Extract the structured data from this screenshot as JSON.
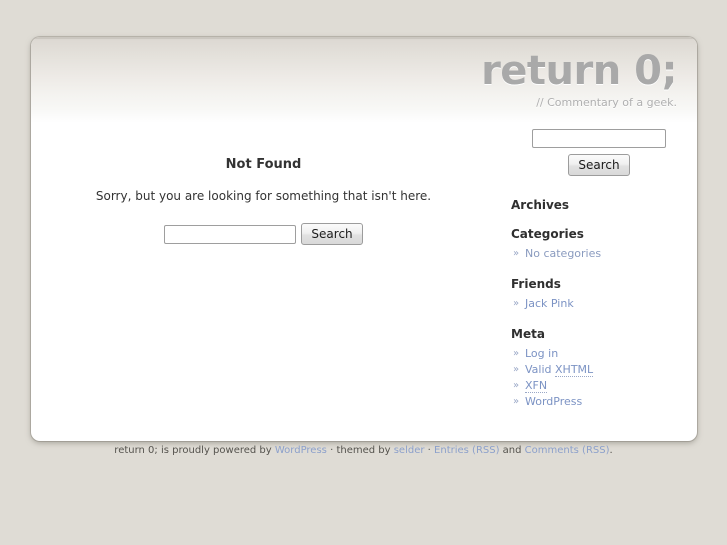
{
  "site": {
    "title": "return 0;",
    "description": "// Commentary of a geek."
  },
  "content": {
    "heading": "Not Found",
    "message": "Sorry, but you are looking for something that isn't here.",
    "search": {
      "value": "",
      "placeholder": "",
      "button_label": "Search"
    }
  },
  "sidebar": {
    "search": {
      "value": "",
      "placeholder": "",
      "button_label": "Search"
    },
    "blocks": [
      {
        "heading": "Archives",
        "items": []
      },
      {
        "heading": "Categories",
        "items": [
          {
            "bullet": "»",
            "label": "No categories",
            "link": false
          }
        ]
      },
      {
        "heading": "Friends",
        "items": [
          {
            "bullet": "»",
            "label": "Jack Pink",
            "link": true
          }
        ]
      },
      {
        "heading": "Meta",
        "items": [
          {
            "bullet": "»",
            "label": "Log in",
            "link": true
          },
          {
            "bullet": "»",
            "label": "Valid XHTML",
            "link": true,
            "abbr": "XHTML"
          },
          {
            "bullet": "»",
            "label": "XFN",
            "link": true,
            "abbr": "XFN"
          },
          {
            "bullet": "»",
            "label": "WordPress",
            "link": true
          }
        ]
      }
    ]
  },
  "footer": {
    "prefix": "return 0; is proudly powered by ",
    "wordpress": "WordPress",
    "sep1": " · ",
    "themed_by": "themed by ",
    "theme_author": "selder",
    "sep2": " · ",
    "entries_rss": "Entries (RSS)",
    "and": " and ",
    "comments_rss": "Comments (RSS)",
    "period": "."
  },
  "colors": {
    "page_background": "#dfdcd5",
    "card_background": "#ffffff",
    "title": "#a9a9a9",
    "link": "#7c93c4",
    "footer_link": "#8ca0cb",
    "text": "#333333"
  }
}
